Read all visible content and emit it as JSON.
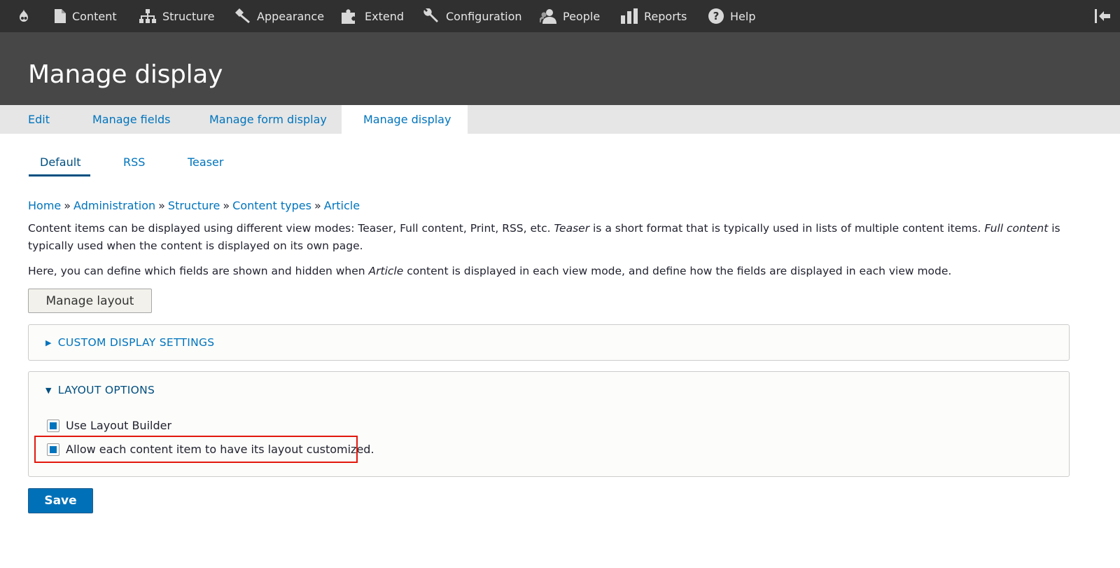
{
  "toolbar": {
    "items": [
      {
        "label": "Content",
        "icon": "file-icon"
      },
      {
        "label": "Structure",
        "icon": "sitemap-icon"
      },
      {
        "label": "Appearance",
        "icon": "paintbrush-icon"
      },
      {
        "label": "Extend",
        "icon": "puzzle-icon"
      },
      {
        "label": "Configuration",
        "icon": "wrench-icon"
      },
      {
        "label": "People",
        "icon": "user-icon"
      },
      {
        "label": "Reports",
        "icon": "bar-chart-icon"
      },
      {
        "label": "Help",
        "icon": "question-icon"
      }
    ],
    "background": "#303030"
  },
  "page": {
    "title": "Manage display"
  },
  "primary_tabs": [
    {
      "label": "Edit",
      "active": false
    },
    {
      "label": "Manage fields",
      "active": false
    },
    {
      "label": "Manage form display",
      "active": false
    },
    {
      "label": "Manage display",
      "active": true
    }
  ],
  "secondary_tabs": [
    {
      "label": "Default",
      "active": true
    },
    {
      "label": "RSS",
      "active": false
    },
    {
      "label": "Teaser",
      "active": false
    }
  ],
  "breadcrumb": [
    {
      "label": "Home"
    },
    {
      "label": "Administration"
    },
    {
      "label": "Structure"
    },
    {
      "label": "Content types"
    },
    {
      "label": "Article"
    }
  ],
  "breadcrumb_separator": "»",
  "description": {
    "p1_a": "Content items can be displayed using different view modes: Teaser, Full content, Print, RSS, etc. ",
    "p1_em1": "Teaser",
    "p1_b": " is a short format that is typically used in lists of multiple content items. ",
    "p1_em2": "Full content",
    "p1_c": " is typically used when the content is displayed on its own page.",
    "p2_a": "Here, you can define which fields are shown and hidden when ",
    "p2_em": "Article",
    "p2_b": " content is displayed in each view mode, and define how the fields are displayed in each view mode."
  },
  "buttons": {
    "manage_layout": "Manage layout",
    "save": "Save"
  },
  "custom_display": {
    "summary": "CUSTOM DISPLAY SETTINGS",
    "open": false
  },
  "layout_options": {
    "summary": "LAYOUT OPTIONS",
    "open": true,
    "checkboxes": [
      {
        "label": "Use Layout Builder",
        "checked": true
      },
      {
        "label": "Allow each content item to have its layout customized.",
        "checked": true
      }
    ]
  },
  "colors": {
    "link": "#0074bd",
    "primary_button": "#0071b8",
    "highlight": "#e3170d",
    "header": "#474747"
  }
}
